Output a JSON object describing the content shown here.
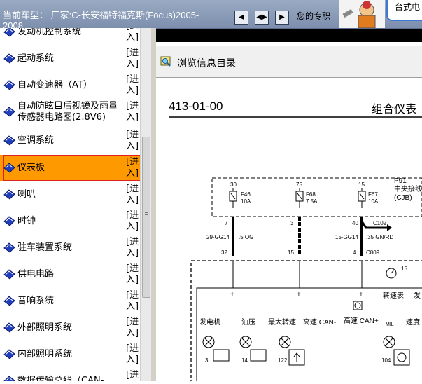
{
  "topbar": {
    "car_title": "当前车型： 厂家:C-长安福特福克斯(Focus)2005-2008",
    "help_text": "您的专职",
    "desktop_tab": "台式电",
    "nav_buttons": [
      "prev",
      "split",
      "next"
    ]
  },
  "menu": {
    "enter_label": "[进入]",
    "items": [
      {
        "label": "发动机控制系统"
      },
      {
        "label": "起动系统"
      },
      {
        "label": "自动变速器（AT）"
      },
      {
        "label": "自动防眩目后视镜及雨量传感器电路图(2.8V6)"
      },
      {
        "label": "空调系统"
      },
      {
        "label": "仪表板",
        "selected": true
      },
      {
        "label": "喇叭"
      },
      {
        "label": "时钟"
      },
      {
        "label": "驻车装置系统"
      },
      {
        "label": "供电电路"
      },
      {
        "label": "音响系统"
      },
      {
        "label": "外部照明系统"
      },
      {
        "label": "内部照明系统"
      },
      {
        "label": "数据传输总线（CAN-"
      }
    ]
  },
  "browse": {
    "label": "浏览信息目录"
  },
  "diagram": {
    "doc_number": "413-01-00",
    "doc_title": "组合仪表",
    "module_id": "P91",
    "module_name": "中央接线",
    "module_code": "(CJB)",
    "fuses": [
      {
        "pin": "30",
        "name": "F46",
        "rating": "10A"
      },
      {
        "pin": "75",
        "name": "F68",
        "rating": "7.5A"
      },
      {
        "pin": "15",
        "name": "F67",
        "rating": "10A"
      }
    ],
    "pins_top": [
      "7",
      "3",
      "40"
    ],
    "connector_c102": "C102",
    "wires": [
      {
        "code": "29-GG14",
        "color": ".5 OG"
      },
      {
        "code": "15-GG14",
        "color": ".35 GN/RD"
      }
    ],
    "pins_bottom": [
      "32",
      "15",
      "4"
    ],
    "connector_c809": "C809",
    "meter_number": "15",
    "meter_label": "转速表",
    "meter_label2": "发",
    "can_low": "高速 CAN-",
    "can_high": "高速 CAN+",
    "lamps": [
      "发电机",
      "油压",
      "最大转速",
      "速度"
    ],
    "lamp_pins": [
      "3",
      "14",
      "122",
      "104"
    ],
    "mil": "MIL"
  }
}
